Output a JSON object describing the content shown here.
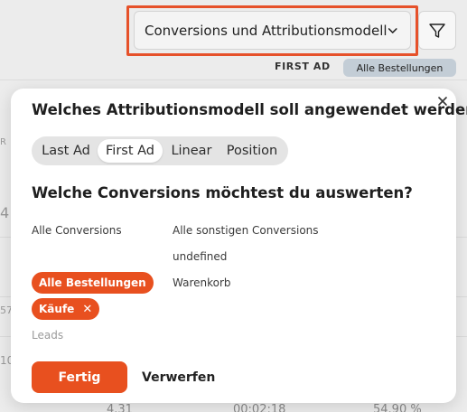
{
  "header": {
    "select_label": "Conversions und Attributionsmodell",
    "select_icon": "chevron-down-icon",
    "filter_icon": "filter-icon",
    "first_ad_label": "FIRST AD",
    "orders_pill": "Alle Bestellungen"
  },
  "background": {
    "fragments": [
      "R",
      "4",
      "57",
      "10"
    ],
    "row": [
      "4.31",
      "00:02:18",
      "54.90 %"
    ]
  },
  "popup": {
    "close_icon": "close-icon",
    "attribution_title": "Welches Attributionsmodell soll angewendet werden?",
    "models": [
      "Last Ad",
      "First Ad",
      "Linear",
      "Position"
    ],
    "active_model": "First Ad",
    "conversions_title": "Welche Conversions möchtest du auswerten?",
    "left_options": {
      "all_conversions": "Alle Conversions",
      "leads": "Leads"
    },
    "selected_chips": [
      "Alle Bestellungen",
      "Käufe"
    ],
    "chip_remove_glyph": "✕",
    "right_options": [
      "Alle sonstigen Conversions",
      "undefined",
      "Warenkorb"
    ],
    "done_button": "Fertig",
    "discard_button": "Verwerfen"
  },
  "colors": {
    "accent": "#e8501f",
    "highlight_border": "#e6512a",
    "pill_bg": "#c3cdd6"
  }
}
